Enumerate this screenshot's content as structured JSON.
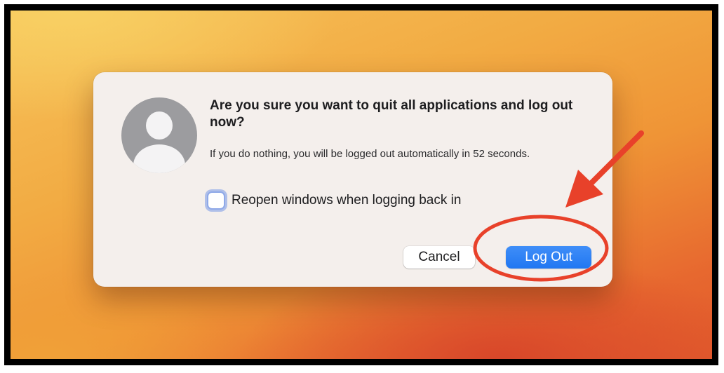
{
  "dialog": {
    "title": "Are you sure you want to quit all applications and log out now?",
    "message": "If you do nothing, you will be logged out automatically in 52 seconds.",
    "checkbox_label": "Reopen windows when logging back in",
    "checkbox_checked": false,
    "cancel_label": "Cancel",
    "logout_label": "Log Out",
    "avatar_icon": "user-silhouette-icon"
  },
  "annotation": {
    "color": "#e8412a",
    "arrow_icon": "arrow-icon",
    "highlight": "circle-highlight"
  },
  "colors": {
    "accent": "#2177f2",
    "dialog_bg": "#f4efec",
    "wallpaper": "#f2ab43"
  }
}
